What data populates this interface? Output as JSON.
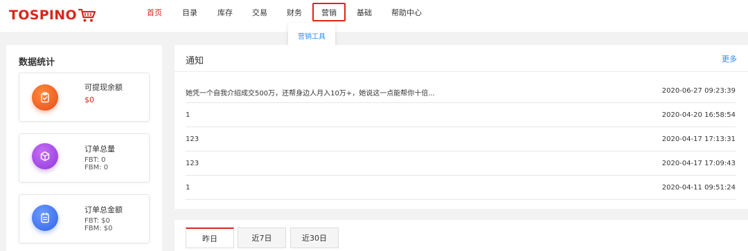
{
  "brand": {
    "name": "TOSPINO",
    "accent": "#d9261c",
    "link": "#2d8cf0"
  },
  "nav": {
    "items": [
      {
        "label": "首页",
        "active": true
      },
      {
        "label": "目录",
        "active": false
      },
      {
        "label": "库存",
        "active": false
      },
      {
        "label": "交易",
        "active": false
      },
      {
        "label": "财务",
        "active": false
      },
      {
        "label": "营销",
        "active": false
      },
      {
        "label": "基础",
        "active": false
      },
      {
        "label": "帮助中心",
        "active": false
      }
    ],
    "dropdown": {
      "item": "营销工具"
    }
  },
  "stats": {
    "title": "数据统计",
    "cards": [
      {
        "label": "可提现余额",
        "value": "$0",
        "icon": "clipboard-check-icon",
        "color": "#f06427"
      },
      {
        "label": "订单总量",
        "fbt": "FBT:  0",
        "fbm": "FBM: 0",
        "icon": "cube-icon",
        "color": "#a64be6"
      },
      {
        "label": "订单总金额",
        "fbt": "FBT:  $0",
        "fbm": "FBM: $0",
        "icon": "calendar-list-icon",
        "color": "#3f74f0"
      }
    ]
  },
  "notices": {
    "title": "通知",
    "more": "更多",
    "rows": [
      {
        "text": "她凭一个自我介绍成交500万，还帮身边人月入10万+，她说这一点能帮你十倍...",
        "date": "2020-06-27 09:23:39"
      },
      {
        "text": "1",
        "date": "2020-04-20 16:58:54"
      },
      {
        "text": "123",
        "date": "2020-04-17 17:13:31"
      },
      {
        "text": "123",
        "date": "2020-04-17 17:09:43"
      },
      {
        "text": "1",
        "date": "2020-04-11 09:51:24"
      }
    ]
  },
  "tabs": [
    {
      "label": "昨日",
      "active": true
    },
    {
      "label": "近7日",
      "active": false
    },
    {
      "label": "近30日",
      "active": false
    }
  ]
}
